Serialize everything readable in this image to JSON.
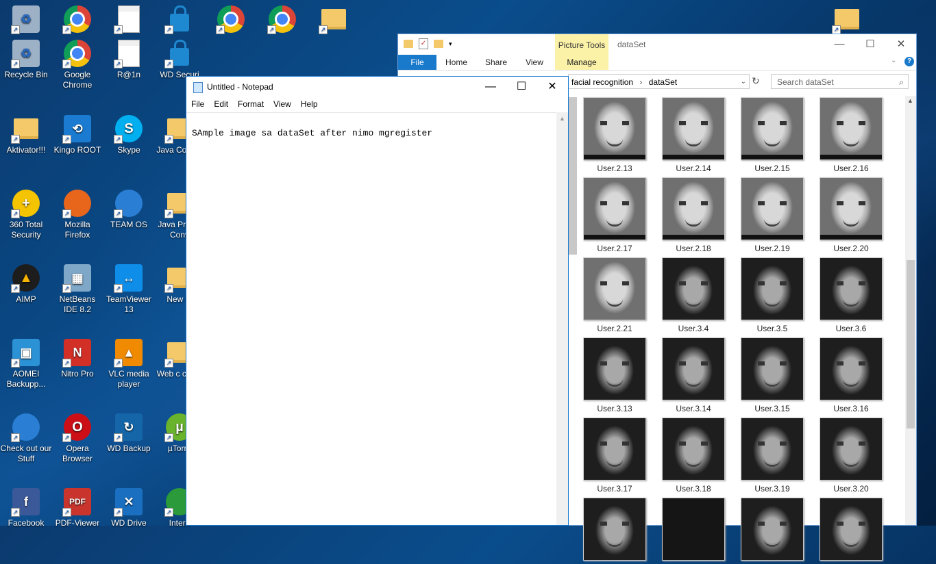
{
  "desktop": {
    "icons": [
      {
        "label": "Recycle Bin",
        "icon": "recycle-bin-icon"
      },
      {
        "label": "Google Chrome",
        "icon": "chrome-icon"
      },
      {
        "label": "R@1n",
        "icon": "document-icon"
      },
      {
        "label": "WD Securi",
        "icon": "lock-icon"
      },
      {
        "label": "Aktivator!!!",
        "icon": "folder-icon"
      },
      {
        "label": "Kingo ROOT",
        "icon": "kingo-root-icon"
      },
      {
        "label": "Skype",
        "icon": "skype-icon"
      },
      {
        "label": "Java Conver",
        "icon": "folder-icon"
      },
      {
        "label": "360 Total Security",
        "icon": "security-icon"
      },
      {
        "label": "Mozilla Firefox",
        "icon": "firefox-icon"
      },
      {
        "label": "TEAM OS",
        "icon": "team-os-icon"
      },
      {
        "label": "Java Pro To Conv",
        "icon": "folder-icon"
      },
      {
        "label": "AIMP",
        "icon": "aimp-icon"
      },
      {
        "label": "NetBeans IDE 8.2",
        "icon": "netbeans-icon"
      },
      {
        "label": "TeamViewer 13",
        "icon": "teamviewer-icon"
      },
      {
        "label": "New fo",
        "icon": "folder-icon"
      },
      {
        "label": "AOMEI Backupp...",
        "icon": "aomei-icon"
      },
      {
        "label": "Nitro Pro",
        "icon": "nitro-icon"
      },
      {
        "label": "VLC media player",
        "icon": "vlc-icon"
      },
      {
        "label": "Web c cours",
        "icon": "folder-icon"
      },
      {
        "label": "Check out our Stuff",
        "icon": "globe-icon"
      },
      {
        "label": "Opera Browser",
        "icon": "opera-icon"
      },
      {
        "label": "WD Backup",
        "icon": "wd-backup-icon"
      },
      {
        "label": "µTorre",
        "icon": "utorrent-icon"
      },
      {
        "label": "Facebook",
        "icon": "facebook-icon"
      },
      {
        "label": "PDF-Viewer",
        "icon": "pdf-icon"
      },
      {
        "label": "WD Drive",
        "icon": "tools-icon"
      },
      {
        "label": "Intern",
        "icon": "internet-icon"
      }
    ]
  },
  "notepad": {
    "title": "Untitled - Notepad",
    "menu": [
      "File",
      "Edit",
      "Format",
      "View",
      "Help"
    ],
    "content": "SAmple image sa dataSet after nimo mgregister",
    "controls": {
      "minimize": "—",
      "maximize": "☐",
      "close": "✕"
    }
  },
  "explorer": {
    "window_name": "dataSet",
    "picture_tools": "Picture Tools",
    "ribbon_tabs": [
      "File",
      "Home",
      "Share",
      "View",
      "Manage"
    ],
    "address": [
      "facial recognition",
      "dataSet"
    ],
    "search_placeholder": "Search dataSet",
    "thumbnails": [
      {
        "name": "User.2.13",
        "kind": "woman"
      },
      {
        "name": "User.2.14",
        "kind": "woman"
      },
      {
        "name": "User.2.15",
        "kind": "woman"
      },
      {
        "name": "User.2.16",
        "kind": "woman"
      },
      {
        "name": "User.2.17",
        "kind": "woman"
      },
      {
        "name": "User.2.18",
        "kind": "woman"
      },
      {
        "name": "User.2.19",
        "kind": "woman"
      },
      {
        "name": "User.2.20",
        "kind": "woman"
      },
      {
        "name": "User.2.21",
        "kind": "woman"
      },
      {
        "name": "User.3.4",
        "kind": "girl"
      },
      {
        "name": "User.3.5",
        "kind": "girl"
      },
      {
        "name": "User.3.6",
        "kind": "girl"
      },
      {
        "name": "User.3.13",
        "kind": "girl"
      },
      {
        "name": "User.3.14",
        "kind": "girl"
      },
      {
        "name": "User.3.15",
        "kind": "girl"
      },
      {
        "name": "User.3.16",
        "kind": "girl"
      },
      {
        "name": "User.3.17",
        "kind": "girl"
      },
      {
        "name": "User.3.18",
        "kind": "girl"
      },
      {
        "name": "User.3.19",
        "kind": "girl"
      },
      {
        "name": "User.3.20",
        "kind": "girl"
      },
      {
        "name": "",
        "kind": "girl"
      },
      {
        "name": "",
        "kind": "dark"
      },
      {
        "name": "",
        "kind": "girl"
      },
      {
        "name": "",
        "kind": "girl"
      }
    ]
  }
}
